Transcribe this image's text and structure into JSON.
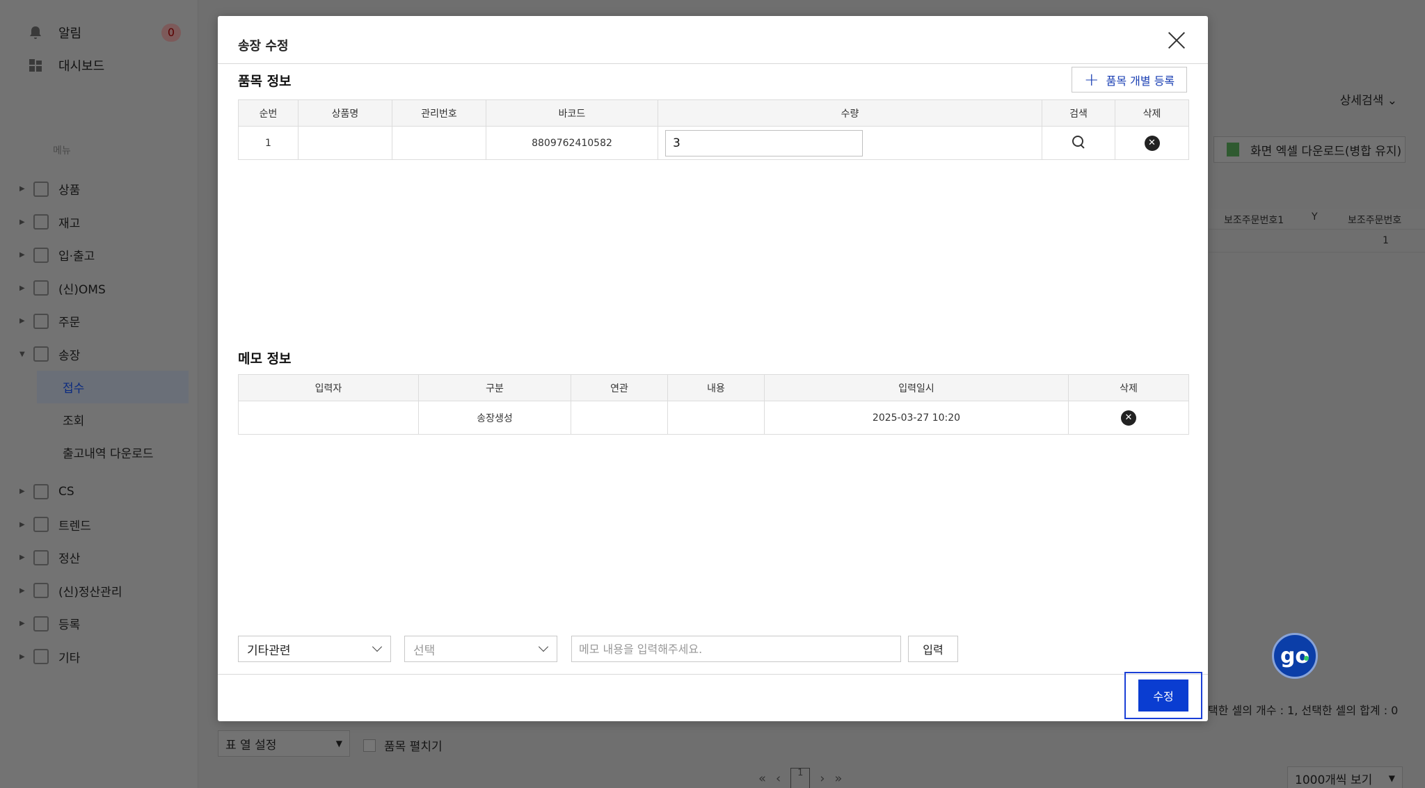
{
  "sidebar": {
    "alerts_label": "알림",
    "alerts_count": "0",
    "dashboard_label": "대시보드",
    "menu_section_label": "메뉴",
    "items": [
      {
        "label": "상품"
      },
      {
        "label": "재고"
      },
      {
        "label": "입·출고"
      },
      {
        "label": "(신)OMS"
      },
      {
        "label": "주문"
      },
      {
        "label": "송장"
      }
    ],
    "sub_items": [
      {
        "label": "접수"
      },
      {
        "label": "조회"
      },
      {
        "label": "출고내역 다운로드"
      }
    ],
    "items_after": [
      {
        "label": "CS"
      },
      {
        "label": "트렌드"
      },
      {
        "label": "정산"
      },
      {
        "label": "(신)정산관리"
      },
      {
        "label": "등록"
      },
      {
        "label": "기타"
      }
    ]
  },
  "background": {
    "detail_search_label": "상세검색",
    "excel_download_label": "화면 엑셀 다운로드(병합 유지)",
    "col_sub_order_1": "보조주문번호1",
    "col_sub_order_2": "보조주문번호",
    "row_value": "1",
    "selection_summary": "택한 셀의 개수 : 1, 선택한 셀의 합계 : 0",
    "column_settings_label": "표 열 설정",
    "expand_items_label": "품목 펼치기",
    "current_page": "1",
    "per_page_label": "1000개씩 보기",
    "go_label": "go"
  },
  "modal": {
    "title": "송장 수정",
    "item_section_title": "품목 정보",
    "add_item_label": "품목 개별 등록",
    "item_columns": [
      "순번",
      "상품명",
      "관리번호",
      "바코드",
      "수량",
      "검색",
      "삭제"
    ],
    "item_rows": [
      {
        "seq": "1",
        "product_name": "",
        "mgmt_no": "",
        "barcode": "8809762410582",
        "quantity": "3"
      }
    ],
    "memo_section_title": "메모 정보",
    "memo_columns": [
      "입력자",
      "구분",
      "연관",
      "내용",
      "입력일시",
      "삭제"
    ],
    "memo_rows": [
      {
        "writer": "",
        "category": "송장생성",
        "related": "",
        "content": "",
        "datetime": "2025-03-27 10:20"
      }
    ],
    "memo_category_select": "기타관련",
    "memo_type_select": "선택",
    "memo_input_placeholder": "메모 내용을 입력해주세요.",
    "memo_submit_label": "입력",
    "submit_label": "수정"
  }
}
